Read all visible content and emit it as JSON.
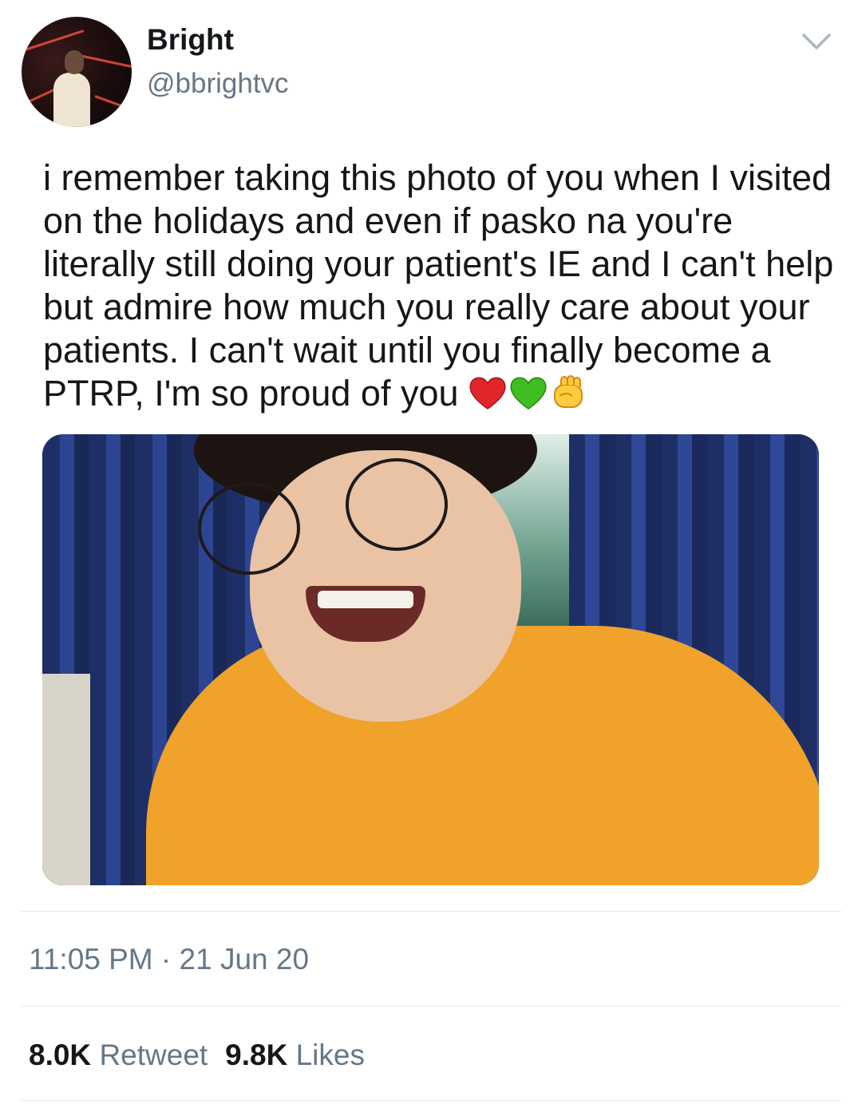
{
  "author": {
    "display_name": "Bright",
    "handle": "@bbrightvc"
  },
  "icons": {
    "menu": "chevron-down-icon",
    "emojis": [
      "red-heart",
      "green-heart",
      "raised-fist"
    ]
  },
  "tweet": {
    "text": "i remember taking this photo of you when I visited on the holidays and even if pasko na you're literally still doing your patient's IE and I can't help but admire how much you really care about your patients. I can't wait until you finally become a PTRP, I'm so proud of you",
    "timestamp": "11:05 PM · 21 Jun 20"
  },
  "stats": {
    "retweets_count": "8.0K",
    "retweets_label": "Retweet",
    "likes_count": "9.8K",
    "likes_label": "Likes"
  },
  "colors": {
    "text": "#14171a",
    "secondary": "#657786",
    "divider": "#e1e8ed",
    "shirt": "#f0a22a",
    "curtain": "#2c4593"
  }
}
